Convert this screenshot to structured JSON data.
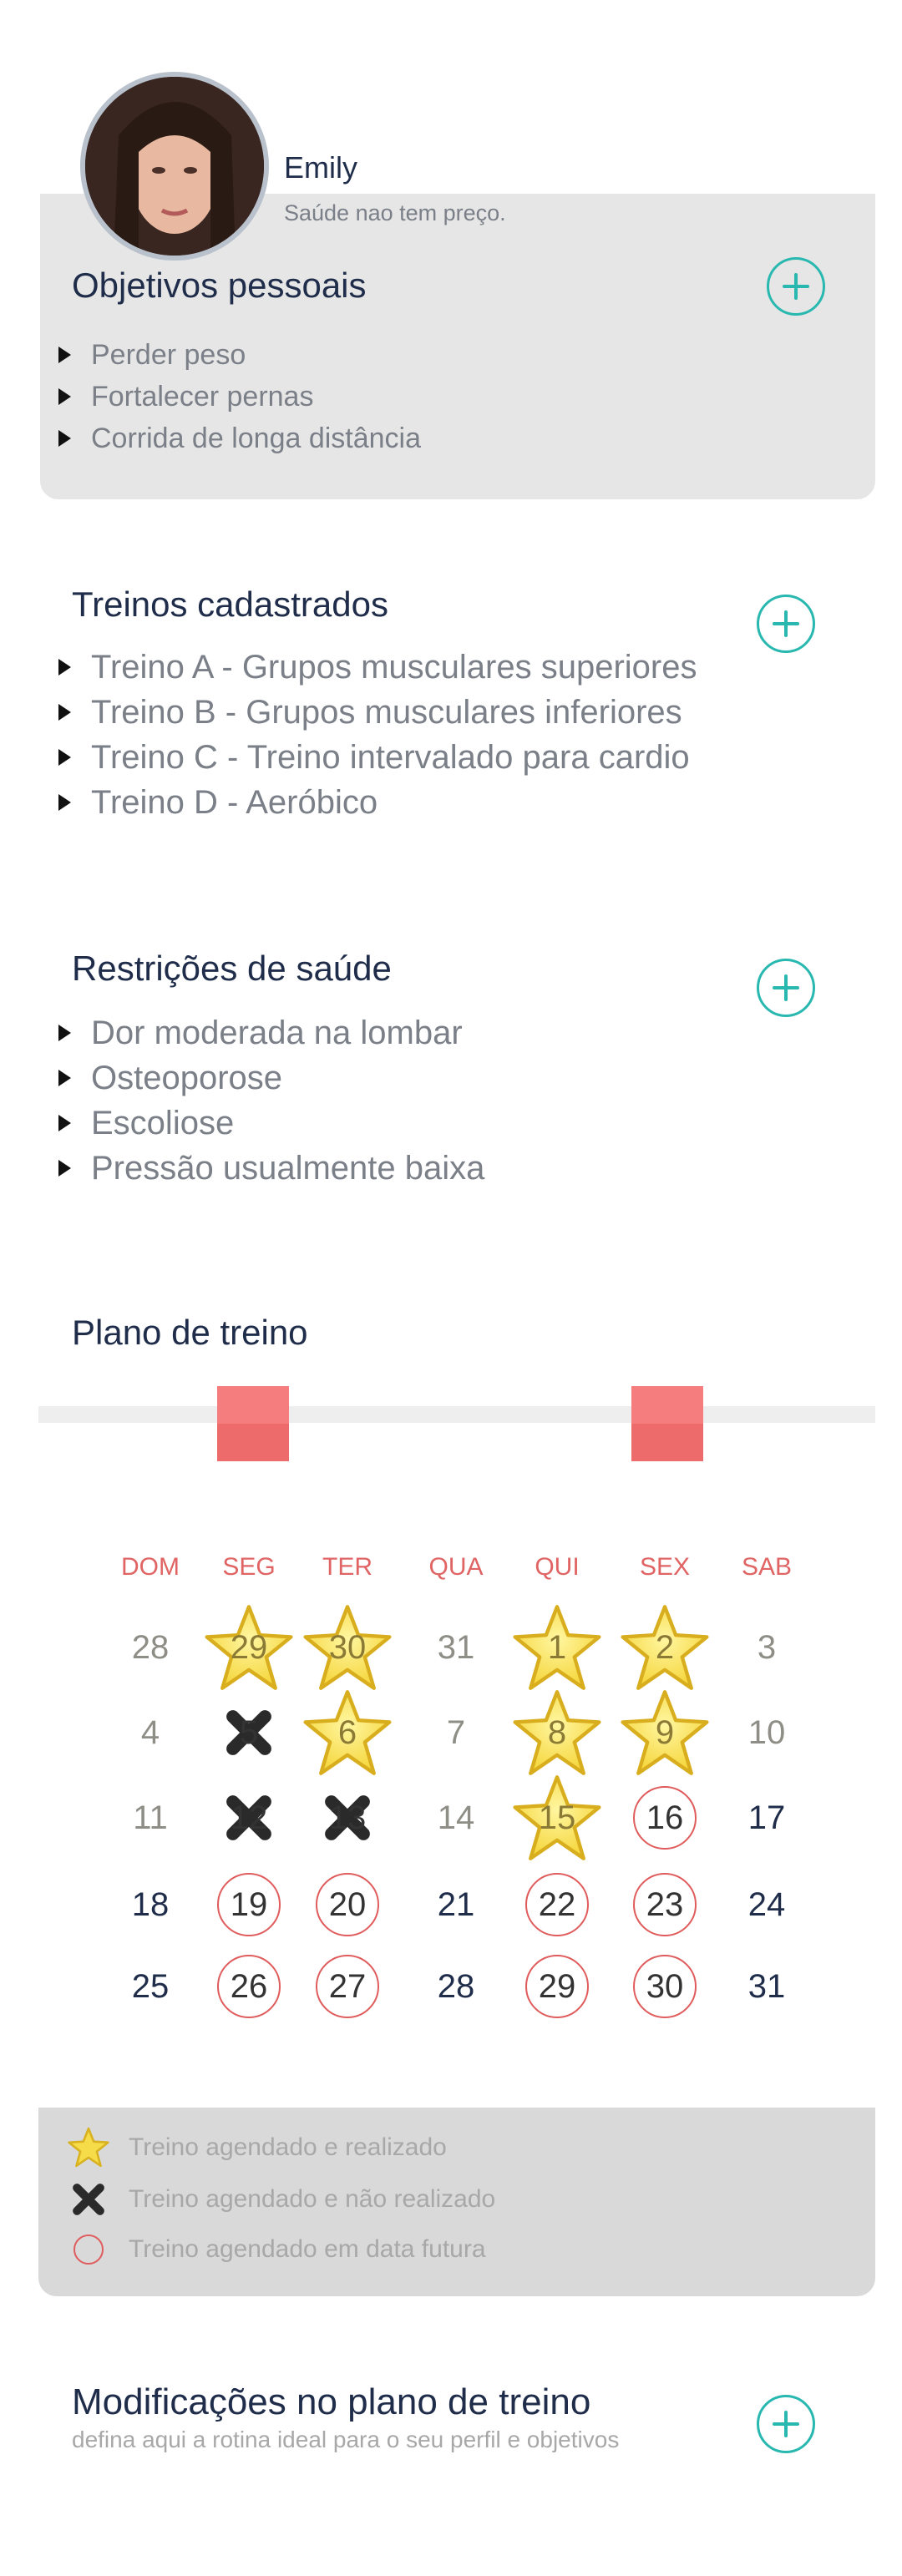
{
  "profile": {
    "name": "Emily",
    "tagline": "Saúde nao tem preço."
  },
  "goals": {
    "title": "Objetivos pessoais",
    "items": [
      "Perder peso",
      "Fortalecer pernas",
      "Corrida de longa distância"
    ]
  },
  "workouts": {
    "title": "Treinos cadastrados",
    "items": [
      "Treino A - Grupos musculares superiores",
      "Treino B - Grupos musculares inferiores",
      "Treino C - Treino intervalado para cardio",
      "Treino D - Aeróbico"
    ]
  },
  "restrictions": {
    "title": "Restrições de saúde",
    "items": [
      "Dor moderada na lombar",
      "Osteoporose",
      "Escoliose",
      "Pressão usualmente baixa"
    ]
  },
  "plan": {
    "title": "Plano de treino",
    "weekdays": [
      "DOM",
      "SEG",
      "TER",
      "QUA",
      "QUI",
      "SEX",
      "SAB"
    ],
    "weeks": [
      [
        {
          "d": "28",
          "s": "prev"
        },
        {
          "d": "29",
          "s": "done"
        },
        {
          "d": "30",
          "s": "done"
        },
        {
          "d": "31",
          "s": "prev"
        },
        {
          "d": "1",
          "s": "done"
        },
        {
          "d": "2",
          "s": "done"
        },
        {
          "d": "3",
          "s": "past"
        }
      ],
      [
        {
          "d": "4",
          "s": "past"
        },
        {
          "d": "5",
          "s": "missed"
        },
        {
          "d": "6",
          "s": "done"
        },
        {
          "d": "7",
          "s": "past"
        },
        {
          "d": "8",
          "s": "done"
        },
        {
          "d": "9",
          "s": "done"
        },
        {
          "d": "10",
          "s": "past"
        }
      ],
      [
        {
          "d": "11",
          "s": "past"
        },
        {
          "d": "12",
          "s": "missed"
        },
        {
          "d": "13",
          "s": "missed"
        },
        {
          "d": "14",
          "s": "past"
        },
        {
          "d": "15",
          "s": "done"
        },
        {
          "d": "16",
          "s": "future"
        },
        {
          "d": "17",
          "s": "plain"
        }
      ],
      [
        {
          "d": "18",
          "s": "plain"
        },
        {
          "d": "19",
          "s": "future"
        },
        {
          "d": "20",
          "s": "future"
        },
        {
          "d": "21",
          "s": "plain"
        },
        {
          "d": "22",
          "s": "future"
        },
        {
          "d": "23",
          "s": "future"
        },
        {
          "d": "24",
          "s": "plain"
        }
      ],
      [
        {
          "d": "25",
          "s": "plain"
        },
        {
          "d": "26",
          "s": "future"
        },
        {
          "d": "27",
          "s": "future"
        },
        {
          "d": "28",
          "s": "plain"
        },
        {
          "d": "29",
          "s": "future"
        },
        {
          "d": "30",
          "s": "future"
        },
        {
          "d": "31",
          "s": "plain"
        }
      ]
    ]
  },
  "legend": {
    "done": "Treino agendado e realizado",
    "missed": "Treino agendado e não realizado",
    "future": "Treino agendado em data futura"
  },
  "modifications": {
    "title": "Modificações no plano de treino",
    "subtitle": "defina aqui a rotina ideal para o seu perfil e objetivos"
  },
  "colors": {
    "accent": "#28b8b0",
    "alert": "#e05c5c",
    "star": "#f5d63c"
  }
}
